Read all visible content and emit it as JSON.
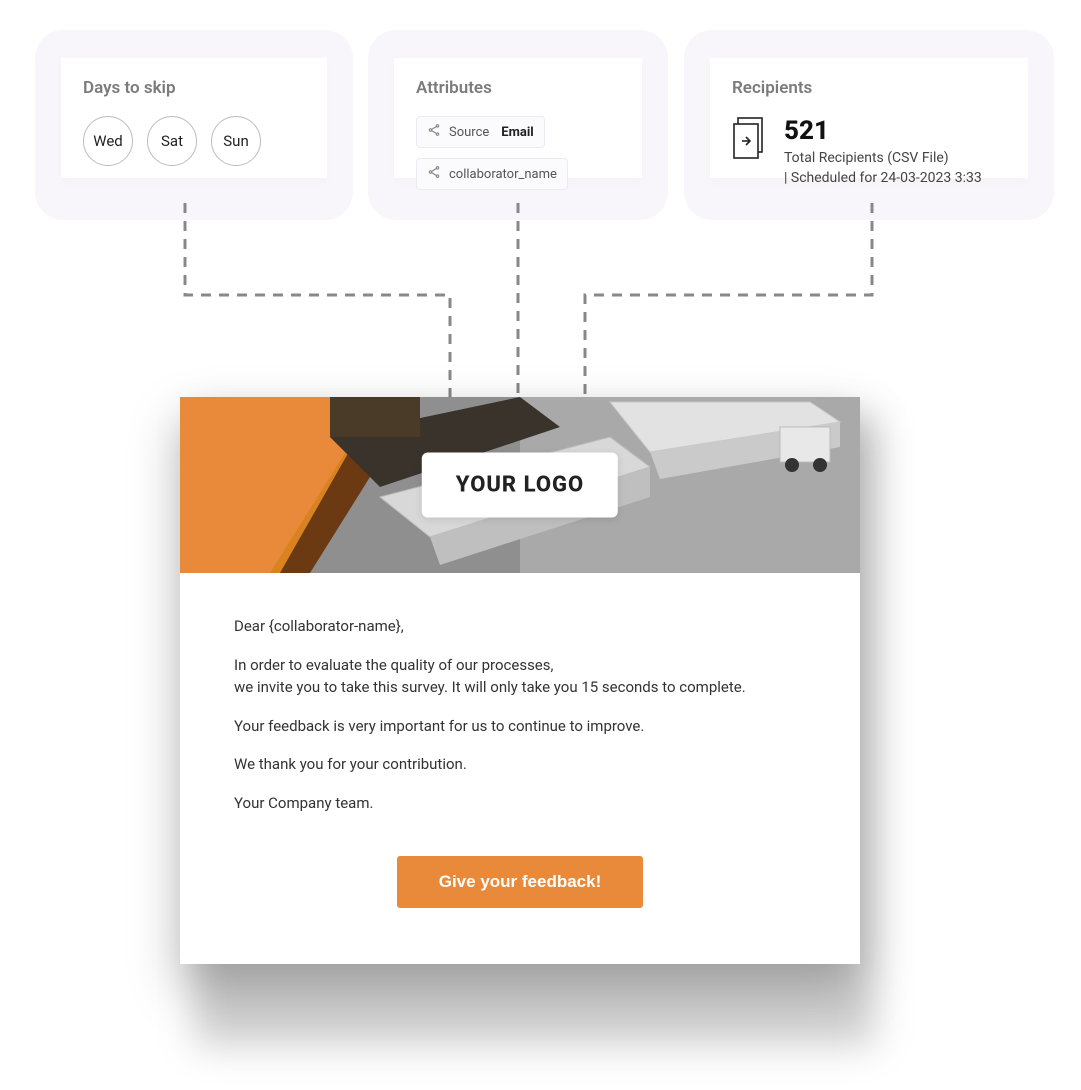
{
  "cards": {
    "days": {
      "title": "Days to skip",
      "items": [
        "Wed",
        "Sat",
        "Sun"
      ]
    },
    "attributes": {
      "title": "Attributes",
      "items": [
        {
          "label": "Source",
          "value": "Email"
        },
        {
          "label": "collaborator_name",
          "value": ""
        }
      ]
    },
    "recipients": {
      "title": "Recipients",
      "count": "521",
      "line1": "Total Recipients (CSV File)",
      "line2": "| Scheduled for 24-03-2023 3:33"
    }
  },
  "email": {
    "logo": "YOUR LOGO",
    "greeting": "Dear {collaborator-name},",
    "para1_line1": "In order to evaluate the quality of our processes,",
    "para1_line2": "we invite you to take this survey. It will only take you 15 seconds to complete.",
    "para2": "Your feedback is very important for us to continue to improve.",
    "para3": "We thank you for your contribution.",
    "signoff": "Your Company team.",
    "cta": "Give your feedback!"
  },
  "colors": {
    "accent": "#e88a3a",
    "cardBg": "#f9f6fb",
    "muted": "#7b7b7b"
  }
}
